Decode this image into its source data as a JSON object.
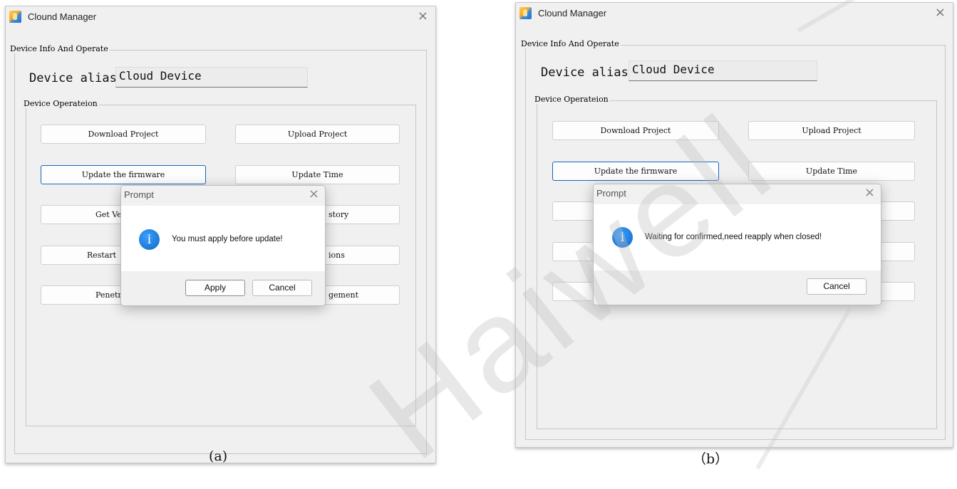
{
  "panels": {
    "a": {
      "window_title": "Clound Manager",
      "group_title": "Device Info And Operate",
      "alias_label": "Device alias",
      "alias_value": "Cloud Device",
      "ops_title": "Device Operateion",
      "buttons": {
        "download": "Download Project",
        "upload": "Upload Project",
        "firmware": "Update the firmware",
        "time": "Update Time",
        "get_v": "Get Ve",
        "history": "story",
        "restart": "Restart",
        "options": "ions",
        "penetr": "Penetr",
        "mgmt": "gement"
      },
      "dialog": {
        "title": "Prompt",
        "message": "You must apply before update!",
        "apply": "Apply",
        "cancel": "Cancel"
      },
      "caption": "(a)"
    },
    "b": {
      "window_title": "Clound Manager",
      "group_title": "Device Info And Operate",
      "alias_label": "Device alias",
      "alias_value": "Cloud Device",
      "ops_title": "Device Operateion",
      "buttons": {
        "download": "Download Project",
        "upload": "Upload Project",
        "firmware": "Update the firmware",
        "time": "Update Time"
      },
      "dialog": {
        "title": "Prompt",
        "message": "Waiting for confirmed,need reapply when closed!",
        "cancel": "Cancel"
      },
      "caption": "（b）"
    }
  },
  "icons": {
    "app": "app-logo-icon",
    "close": "close-icon",
    "info": "info-icon",
    "info_glyph": "i",
    "close_glyph": "×"
  },
  "watermark": "Haiwell",
  "colors": {
    "accent": "#1565c0",
    "info": "#1c78d6",
    "window_bg": "#f0f0f0"
  }
}
